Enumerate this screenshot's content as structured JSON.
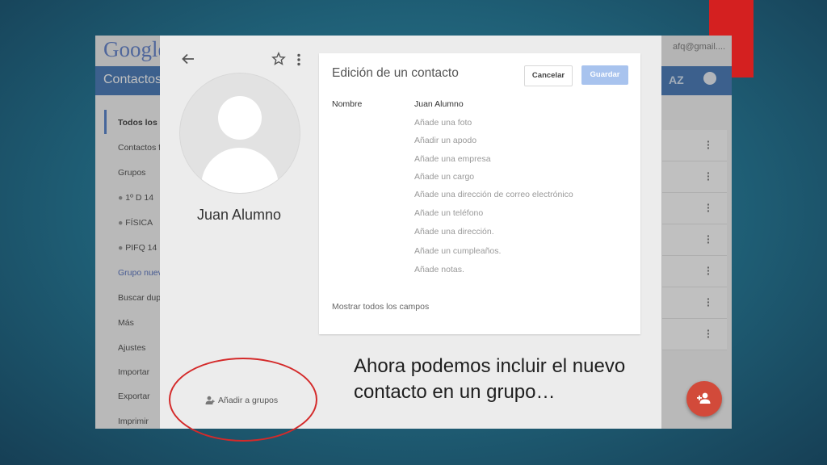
{
  "app": {
    "logo_text": "Google",
    "account_email": "afq@gmail....",
    "section_title": "Contactos",
    "sort_label": "AZ",
    "sidebar_items": [
      "Todos los c",
      "Contactos f",
      "Grupos",
      "1º D 14",
      "FÍSICA",
      "PIFQ 14",
      "Grupo nuev",
      "Buscar dup",
      "Más",
      "Ajustes",
      "Importar",
      "Exportar",
      "Imprimir"
    ]
  },
  "dialog": {
    "contact_name": "Juan Alumno",
    "add_groups_label": "Añadir a grupos",
    "edit_title": "Edición de un contacto",
    "cancel_label": "Cancelar",
    "save_label": "Guardar",
    "name_field_label": "Nombre",
    "name_value": "Juan Alumno",
    "fields": [
      "Añade una foto",
      "Añadir un apodo",
      "Añade una empresa",
      "Añade un cargo",
      "Añade una dirección de correo electrónico",
      "Añade un teléfono",
      "Añade una dirección.",
      "Añade un cumpleaños.",
      "Añade notas."
    ],
    "show_all_label": "Mostrar todos los campos"
  },
  "slide": {
    "caption_line1": "Ahora podemos incluir el nuevo",
    "caption_line2": "contacto en un grupo…",
    "accent_color": "#d42020"
  },
  "icons": [
    "back-arrow-icon",
    "star-icon",
    "more-vert-icon",
    "add-group-icon",
    "add-person-icon",
    "chat-icon",
    "sort-az-icon"
  ]
}
